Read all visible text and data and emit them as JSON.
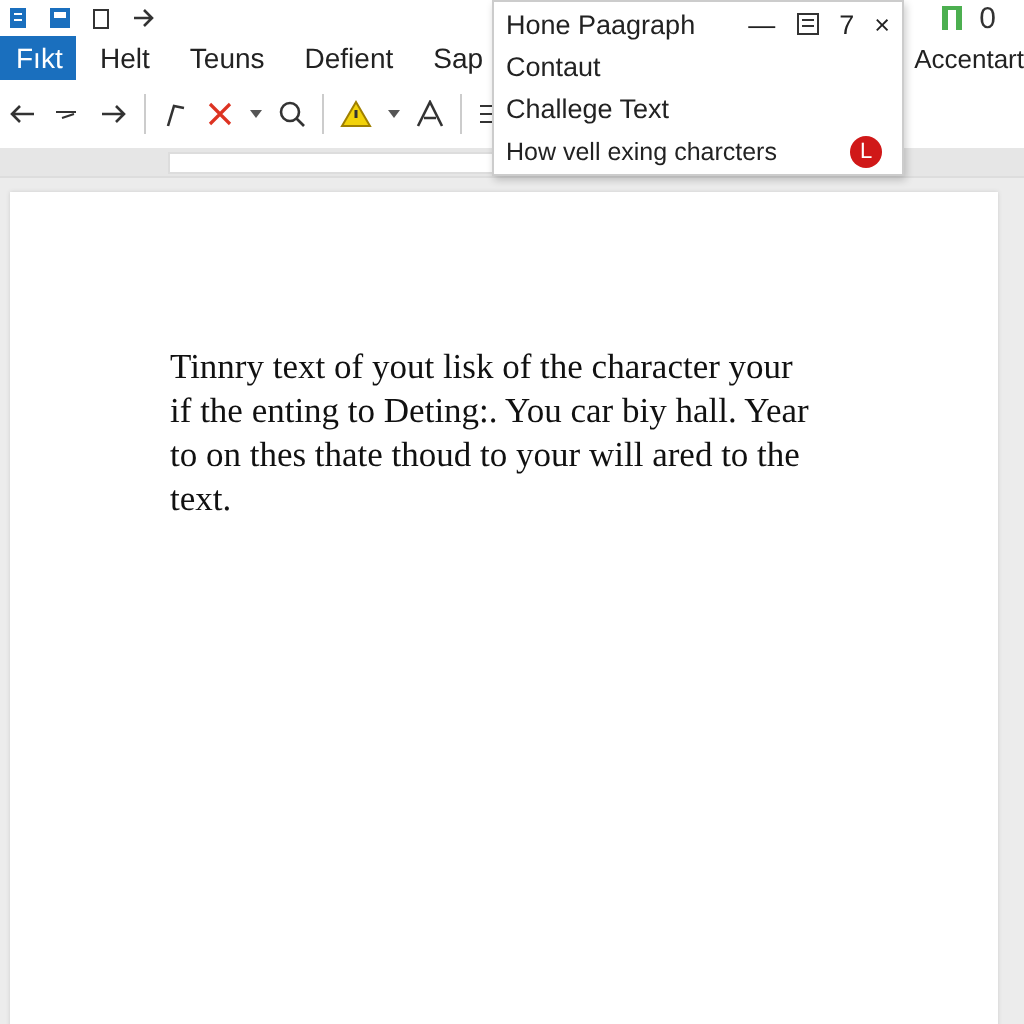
{
  "title_bar": {
    "right_text": "0"
  },
  "menu": [
    {
      "label": "Fıkt",
      "selected": true
    },
    {
      "label": "Helt",
      "selected": false
    },
    {
      "label": "Teuns",
      "selected": false
    },
    {
      "label": "Defient",
      "selected": false
    },
    {
      "label": "Sap",
      "selected": false
    }
  ],
  "menu_right": "Accentart",
  "popup": {
    "title": "Hone Paagraph",
    "count": "7",
    "close": "×",
    "minimize": "—",
    "items": [
      {
        "label": "Contaut"
      },
      {
        "label": "Challege Text"
      },
      {
        "label": "How vell exing charcters",
        "badge": "L"
      }
    ]
  },
  "document": {
    "paragraph": "Tinnry text of yout lisk of the character your if the enting to Deting:. You car biy hall. Year to on thes thate thoud to your will ared to the text."
  }
}
